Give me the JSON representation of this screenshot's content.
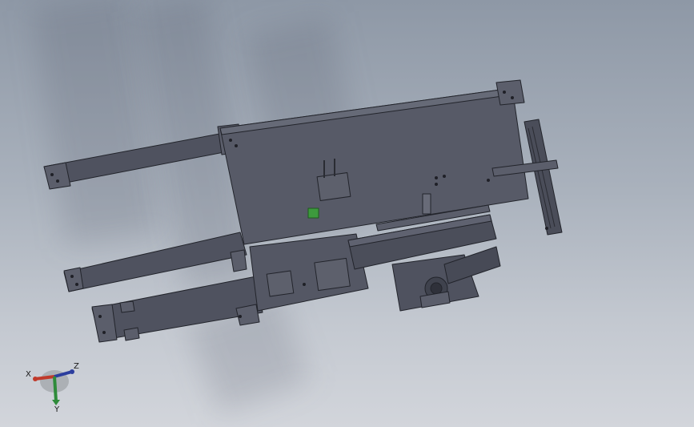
{
  "viewport": {
    "background_top": "#8e98a6",
    "background_bottom": "#d2d5db",
    "model_color": "#4f525f",
    "model_edge_color": "#22242b",
    "highlight_color": "#3d9a3d"
  },
  "triad": {
    "x_label": "X",
    "y_label": "Y",
    "z_label": "Z",
    "x_color": "#c0392b",
    "y_color": "#2e8b3a",
    "z_color": "#2c3e9e"
  }
}
